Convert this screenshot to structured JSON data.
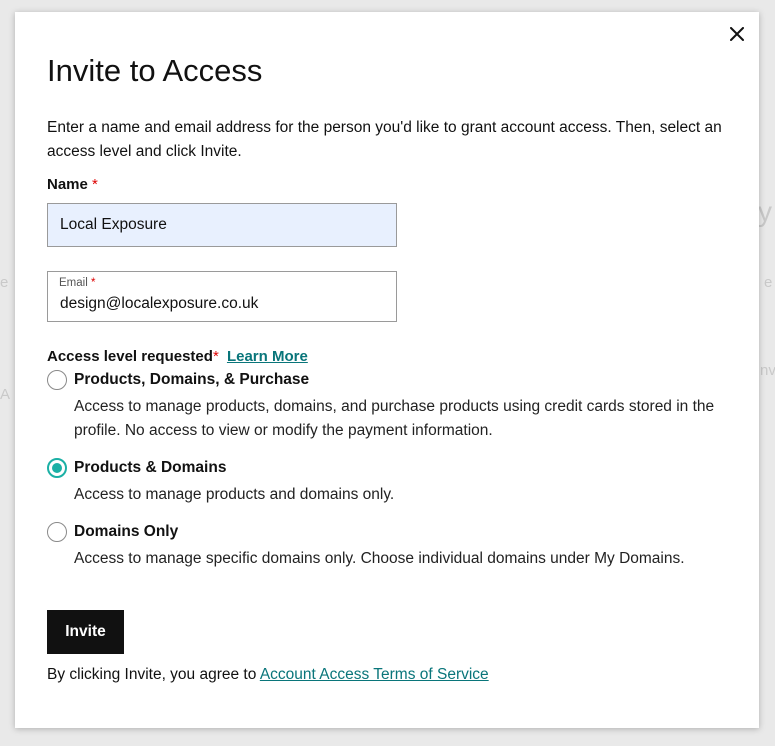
{
  "background": {
    "fragments": [
      "y",
      "e",
      "e",
      "A",
      "nv"
    ]
  },
  "modal": {
    "close_icon": "close-icon",
    "title": "Invite to Access",
    "intro": "Enter a name and email address for the person you'd like to grant account access. Then, select an access level and click Invite.",
    "name_field": {
      "label": "Name",
      "required_mark": "*",
      "value": "Local Exposure"
    },
    "email_field": {
      "label": "Email",
      "required_mark": "*",
      "value": "design@localexposure.co.uk"
    },
    "access": {
      "label": "Access level requested",
      "required_mark": "*",
      "learn_more": "Learn More",
      "options": [
        {
          "title": "Products, Domains, & Purchase",
          "description": "Access to manage products, domains, and purchase products using credit cards stored in the profile. No access to view or modify the payment information.",
          "selected": false
        },
        {
          "title": "Products & Domains",
          "description": "Access to manage products and domains only.",
          "selected": true
        },
        {
          "title": "Domains Only",
          "description": "Access to manage specific domains only. Choose individual domains under My Domains.",
          "selected": false
        }
      ]
    },
    "invite_label": "Invite",
    "agree_text": "By clicking Invite, you agree to ",
    "tos_link": "Account Access Terms of Service",
    "colors": {
      "accent": "#1bb0a5",
      "link": "#09757a",
      "required": "#dd0000",
      "button": "#111111",
      "input_fill": "#e8f0fe"
    }
  }
}
